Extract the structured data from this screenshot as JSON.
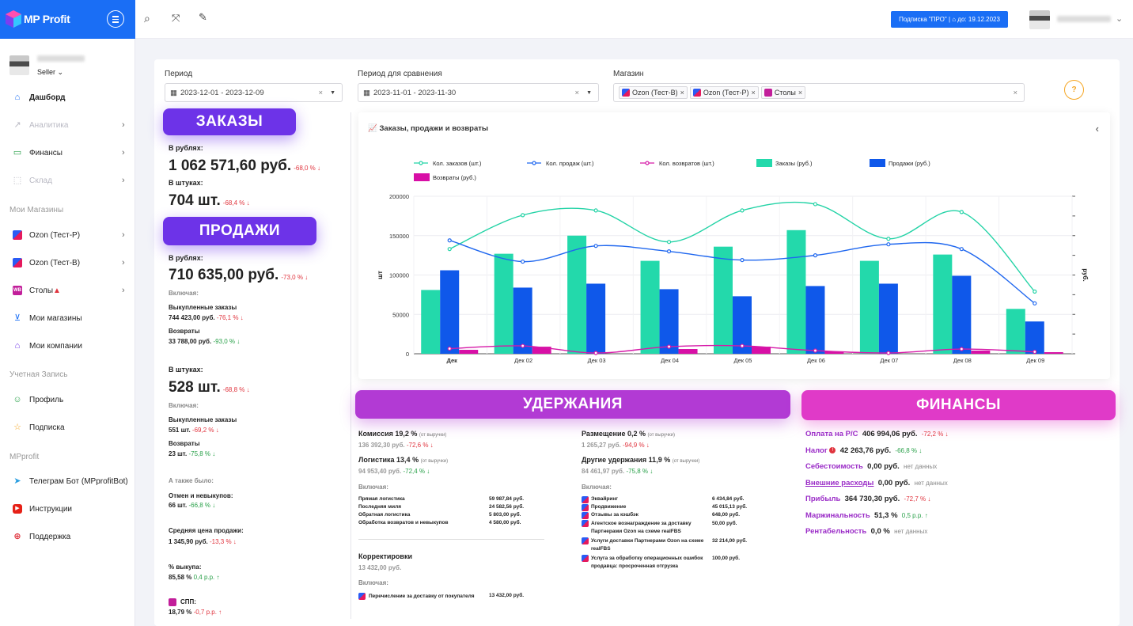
{
  "app": {
    "name": "MP Profit",
    "subscription": "Подписка \"ПРО\" | ⌂ до: 19.12.2023"
  },
  "sidebar": {
    "role": "Seller",
    "items": [
      {
        "label": "Дашборд",
        "icon": "home-icon"
      },
      {
        "label": "Аналитика",
        "icon": "chart-icon"
      },
      {
        "label": "Финансы",
        "icon": "wallet-icon"
      },
      {
        "label": "Склад",
        "icon": "box-icon"
      }
    ],
    "section_stores": "Мои Магазины",
    "stores": [
      {
        "label": "Ozon (Тест-Р)"
      },
      {
        "label": "Ozon (Тест-В)"
      },
      {
        "label": "Столы"
      }
    ],
    "my_stores": "Мои магазины",
    "my_companies": "Мои компании",
    "section_account": "Учетная Запись",
    "profile": "Профиль",
    "subscription": "Подписка",
    "section_mpprofit": "MPprofit",
    "telegram": "Телеграм Бот (MPprofitBot)",
    "instructions": "Инструкции",
    "support": "Поддержка"
  },
  "filters": {
    "period_label": "Период",
    "period_value": "2023-12-01 - 2023-12-09",
    "compare_label": "Период для сравнения",
    "compare_value": "2023-11-01 - 2023-11-30",
    "stores_label": "Магазин",
    "store_tags": [
      "Ozon (Тест-В)",
      "Ozon (Тест-Р)",
      "Столы"
    ]
  },
  "orders": {
    "banner": "ЗАКАЗЫ",
    "rub_label": "В рублях:",
    "rub_value": "1 062 571,60 руб.",
    "rub_delta": "-68,0 % ↓",
    "pcs_label": "В штуках:",
    "pcs_value": "704 шт.",
    "pcs_delta": "-68,4 % ↓"
  },
  "sales": {
    "banner": "ПРОДАЖИ",
    "rub_label": "В рублях:",
    "rub_value": "710 635,00 руб.",
    "rub_delta": "-73,0 % ↓",
    "incl": "Включая:",
    "bought_label": "Выкупленные заказы",
    "bought_value": "744 423,00 руб.",
    "bought_delta": "-76,1 % ↓",
    "returns_label": "Возвраты",
    "returns_value": "33 788,00 руб.",
    "returns_delta": "-93,0 % ↓",
    "pcs_label": "В штуках:",
    "pcs_value": "528 шт.",
    "pcs_delta": "-68,8 % ↓",
    "incl2": "Включая:",
    "bought_pcs_label": "Выкупленные заказы",
    "bought_pcs_value": "551 шт.",
    "bought_pcs_delta": "-69,2 % ↓",
    "returns_pcs_label": "Возвраты",
    "returns_pcs_value": "23 шт.",
    "returns_pcs_delta": "-75,8 % ↓",
    "also": "А также было:",
    "cancel_label": "Отмен и невыкупов:",
    "cancel_value": "66 шт.",
    "cancel_delta": "-66,8 % ↓",
    "avg_label": "Средняя цена продажи:",
    "avg_value": "1 345,90 руб.",
    "avg_delta": "-13,3 % ↓",
    "buyout_label": "% выкупа:",
    "buyout_value": "85,58 %",
    "buyout_delta": "0,4 р.р. ↑",
    "spp_label": "СПП:",
    "spp_value": "18,79 %",
    "spp_delta": "-0,7 р.р. ↑"
  },
  "chart_card": {
    "title": "Заказы, продажи и возвраты",
    "collapse": "‹"
  },
  "chart_data": {
    "type": "bar",
    "categories": [
      "Дек",
      "Дек 02",
      "Дек 03",
      "Дек 04",
      "Дек 05",
      "Дек 06",
      "Дек 07",
      "Дек 08",
      "Дек 09"
    ],
    "ylabel": "шт",
    "y2label": "руб.",
    "ylim": [
      0,
      200000
    ],
    "yticks": [
      "0",
      "50000",
      "100000",
      "150000",
      "200000"
    ],
    "series": [
      {
        "name": "Кол. заказов (шт.)",
        "kind": "line",
        "color": "#23d3a6",
        "values": [
          133000,
          176000,
          182000,
          142000,
          182000,
          190000,
          146000,
          180000,
          79000
        ]
      },
      {
        "name": "Кол. продаж (шт.)",
        "kind": "line",
        "color": "#1f67ef",
        "values": [
          144000,
          117000,
          137000,
          130000,
          119000,
          125000,
          139000,
          133000,
          64000
        ]
      },
      {
        "name": "Кол. возвратов (шт.)",
        "kind": "line",
        "color": "#d61aa8",
        "values": [
          6500,
          10000,
          1000,
          9000,
          10000,
          4000,
          1000,
          6000,
          2500
        ]
      },
      {
        "name": "Заказы (руб.)",
        "kind": "bar",
        "color": "#23d9ab",
        "values": [
          81000,
          127000,
          150000,
          118000,
          136000,
          157000,
          118000,
          126000,
          57000
        ]
      },
      {
        "name": "Продажи (руб.)",
        "kind": "bar",
        "color": "#0f58ea",
        "values": [
          106000,
          84000,
          89000,
          82000,
          73000,
          86000,
          89000,
          99000,
          41000
        ]
      },
      {
        "name": "Возвраты (руб.)",
        "kind": "bar",
        "color": "#d80fa6",
        "values": [
          5000,
          9000,
          0,
          6000,
          9000,
          3000,
          0,
          4000,
          2000
        ]
      }
    ]
  },
  "deductions": {
    "banner": "УДЕРЖАНИЯ",
    "commission_label": "Комиссия 19,2 %",
    "commission_note": "(от выручки)",
    "commission_value": "136 392,30 руб.",
    "commission_delta": "-72,6 % ↓",
    "logistics_label": "Логистика 13,4 %",
    "logistics_note": "(от выручки)",
    "logistics_value": "94 953,40 руб.",
    "logistics_delta": "-72,4 % ↓",
    "incl": "Включая:",
    "logistics_items": [
      {
        "name": "Прямая логистика",
        "value": "59 987,84 руб."
      },
      {
        "name": "Последняя миля",
        "value": "24 582,56 руб."
      },
      {
        "name": "Обратная логистика",
        "value": "5 803,00 руб."
      },
      {
        "name": "Обработка возвратов и невыкупов",
        "value": "4 580,00 руб."
      }
    ],
    "corrections_label": "Корректировки",
    "corrections_value": "13 432,00 руб.",
    "incl2": "Включая:",
    "corr_item_name": "Перечисление за доставку от покупателя",
    "corr_item_value": "13 432,00 руб.",
    "placement_label": "Размещение 0,2 %",
    "placement_note": "(от выручки)",
    "placement_value": "1 265,27 руб.",
    "placement_delta": "-94,9 % ↓",
    "other_label": "Другие удержания 11,9 %",
    "other_note": "(от выручки)",
    "other_value": "84 461,97 руб.",
    "other_delta": "-75,8 % ↓",
    "incl3": "Включая:",
    "other_items": [
      {
        "name": "Эквайринг",
        "value": "6 434,84 руб."
      },
      {
        "name": "Продвижение",
        "value": "45 015,13 руб."
      },
      {
        "name": "Отзывы за кэшбэк",
        "value": "648,00 руб."
      },
      {
        "name": "Агентское вознаграждение за доставку Партнерами Ozon на схеме realFBS",
        "value": "50,00 руб."
      },
      {
        "name": "Услуги доставки Партнерами Ozon на схеме realFBS",
        "value": "32 214,00 руб."
      },
      {
        "name": "Услуга за обработку операционных ошибок продавца: просроченная отгрузка",
        "value": "100,00 руб."
      }
    ]
  },
  "finance": {
    "banner": "ФИНАНСЫ",
    "rows": [
      {
        "label": "Оплата на Р/С",
        "value": "406 994,06 руб.",
        "delta": "-72,2 % ↓",
        "tone": "red"
      },
      {
        "label": "Налог",
        "value": "42 263,76 руб.",
        "delta": "-66,8 % ↓",
        "tone": "red"
      },
      {
        "label": "Себестоимость",
        "value": "0,00 руб.",
        "delta": "нет данных",
        "tone": "grey"
      },
      {
        "label": "Внешние расходы",
        "value": "0,00 руб.",
        "delta": "нет данных",
        "tone": "grey"
      },
      {
        "label": "Прибыль",
        "value": "364 730,30 руб.",
        "delta": "-72,7 % ↓",
        "tone": "red"
      },
      {
        "label": "Маржинальность",
        "value": "51,3 %",
        "delta": "0,5 р.р. ↑",
        "tone": "green"
      },
      {
        "label": "Рентабельность",
        "value": "0,0 %",
        "delta": "нет данных",
        "tone": "grey"
      }
    ]
  },
  "colors": {
    "brand": "#1a6ef5",
    "purple": "#6d33e8",
    "magenta": "#b23ad4",
    "pink": "#e03ac8",
    "fin_label": "#9a2bc7"
  }
}
